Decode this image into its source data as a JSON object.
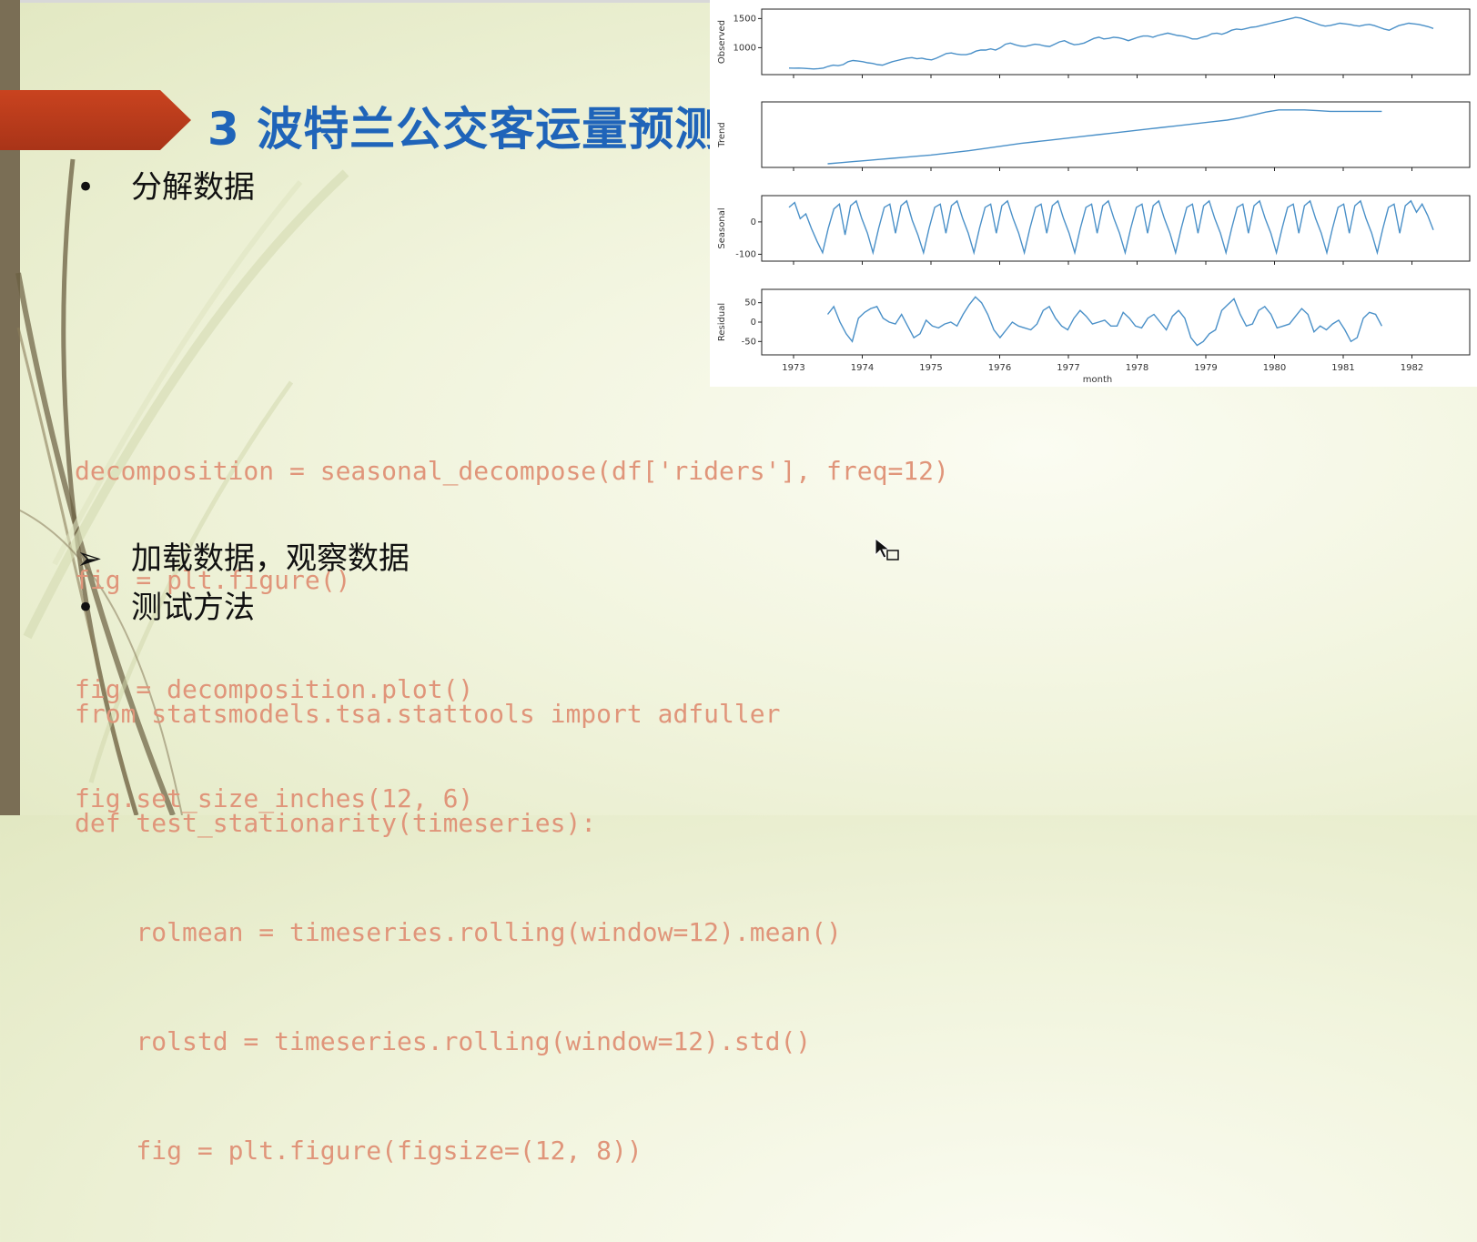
{
  "slide": {
    "title": "3 波特兰公交客运量预测",
    "bullet1": {
      "mark": "•",
      "text": "分解数据"
    },
    "code1": [
      "decomposition = seasonal_decompose(df['riders'], freq=12)",
      "fig = plt.figure()",
      "fig = decomposition.plot()",
      "fig.set_size_inches(12, 6)"
    ],
    "bullet2": {
      "mark": "➢",
      "text": "加载数据，观察数据"
    },
    "bullet3": {
      "mark": "•",
      "text": "测试方法"
    },
    "code2": [
      "from statsmodels.tsa.stattools import adfuller",
      "def test_stationarity(timeseries):",
      "    rolmean = timeseries.rolling(window=12).mean()",
      "    rolstd = timeseries.rolling(window=12).std()",
      "    fig = plt.figure(figsize=(12, 8))"
    ],
    "colors": {
      "title": "#1f64b9",
      "arrow": "#b83a1b",
      "code": "#e0957a",
      "line": "#4a90c8"
    }
  },
  "chart_data": {
    "type": "line",
    "xlabel": "month",
    "x_ticks": [
      "1973",
      "1974",
      "1975",
      "1976",
      "1977",
      "1978",
      "1979",
      "1980",
      "1981",
      "1982"
    ],
    "panels": [
      {
        "ylabel": "Observed",
        "yticks": [
          "1500",
          "1000"
        ],
        "ylim": [
          600,
          1600
        ],
        "values": [
          650,
          648,
          650,
          645,
          640,
          635,
          640,
          650,
          680,
          700,
          690,
          710,
          760,
          780,
          770,
          760,
          740,
          730,
          710,
          700,
          730,
          760,
          780,
          800,
          820,
          830,
          810,
          820,
          800,
          790,
          820,
          860,
          900,
          910,
          890,
          880,
          880,
          900,
          940,
          960,
          960,
          980,
          960,
          1000,
          1060,
          1080,
          1050,
          1030,
          1020,
          1040,
          1060,
          1050,
          1030,
          1020,
          1060,
          1100,
          1120,
          1080,
          1050,
          1060,
          1080,
          1120,
          1160,
          1180,
          1150,
          1160,
          1180,
          1170,
          1150,
          1120,
          1150,
          1180,
          1200,
          1200,
          1180,
          1210,
          1230,
          1250,
          1230,
          1210,
          1200,
          1180,
          1150,
          1150,
          1180,
          1200,
          1240,
          1250,
          1230,
          1260,
          1300,
          1320,
          1310,
          1330,
          1350,
          1360,
          1380,
          1400,
          1420,
          1440,
          1460,
          1480,
          1500,
          1520,
          1510,
          1480,
          1450,
          1420,
          1390,
          1370,
          1380,
          1400,
          1420,
          1410,
          1400,
          1380,
          1370,
          1390,
          1400,
          1380,
          1350,
          1320,
          1300,
          1340,
          1380,
          1400,
          1420,
          1410,
          1400,
          1380,
          1360,
          1330
        ]
      },
      {
        "ylabel": "Trend",
        "yticks": [],
        "ylim": [
          700,
          1500
        ],
        "values": [
          700,
          715,
          730,
          745,
          760,
          775,
          790,
          805,
          820,
          840,
          860,
          880,
          905,
          930,
          955,
          980,
          1000,
          1020,
          1040,
          1060,
          1080,
          1100,
          1120,
          1140,
          1160,
          1180,
          1200,
          1220,
          1240,
          1260,
          1280,
          1300,
          1330,
          1370,
          1410,
          1440,
          1440,
          1440,
          1430,
          1420,
          1420,
          1420,
          1420,
          1420
        ]
      },
      {
        "ylabel": "Seasonal",
        "yticks": [
          "0",
          "-100"
        ],
        "ylim": [
          -110,
          70
        ],
        "values": [
          45,
          60,
          10,
          25,
          -20,
          -60,
          -95,
          -20,
          40,
          55,
          -40,
          50,
          65,
          10,
          -35,
          -95,
          -20,
          45,
          55,
          -35,
          50,
          65,
          5,
          -40,
          -95,
          -20,
          45,
          55,
          -35,
          50,
          65,
          10,
          -35,
          -95,
          -20,
          45,
          55,
          -35,
          50,
          65,
          10,
          -35,
          -95,
          -20,
          45,
          55,
          -35,
          50,
          65,
          10,
          -35,
          -95,
          -20,
          45,
          55,
          -35,
          50,
          65,
          10,
          -35,
          -95,
          -20,
          45,
          55,
          -35,
          50,
          65,
          10,
          -35,
          -95,
          -20,
          45,
          55,
          -35,
          50,
          65,
          10,
          -35,
          -95,
          -20,
          45,
          55,
          -35,
          50,
          65,
          10,
          -35,
          -95,
          -20,
          45,
          55,
          -35,
          50,
          65,
          10,
          -35,
          -95,
          -20,
          45,
          55,
          -35,
          50,
          65,
          10,
          -35,
          -95,
          -20,
          45,
          55,
          -35,
          50,
          65,
          30,
          55,
          20,
          -25
        ]
      },
      {
        "ylabel": "Residual",
        "yticks": [
          "50",
          "0",
          "-50"
        ],
        "ylim": [
          -75,
          75
        ],
        "values": [
          20,
          40,
          0,
          -30,
          -50,
          10,
          25,
          35,
          40,
          10,
          0,
          -5,
          20,
          -10,
          -40,
          -30,
          5,
          -10,
          -15,
          -5,
          0,
          -10,
          20,
          45,
          65,
          50,
          20,
          -20,
          -40,
          -20,
          0,
          -10,
          -15,
          -20,
          -5,
          30,
          40,
          10,
          -10,
          -20,
          10,
          30,
          15,
          -5,
          0,
          5,
          -10,
          -10,
          25,
          10,
          -10,
          -15,
          10,
          20,
          0,
          -20,
          15,
          30,
          10,
          -40,
          -60,
          -50,
          -30,
          -20,
          30,
          45,
          60,
          20,
          -10,
          -5,
          30,
          40,
          20,
          -15,
          -10,
          -5,
          15,
          35,
          20,
          -25,
          -10,
          -20,
          -5,
          5,
          -20,
          -50,
          -40,
          10,
          25,
          20,
          -10
        ]
      }
    ]
  }
}
